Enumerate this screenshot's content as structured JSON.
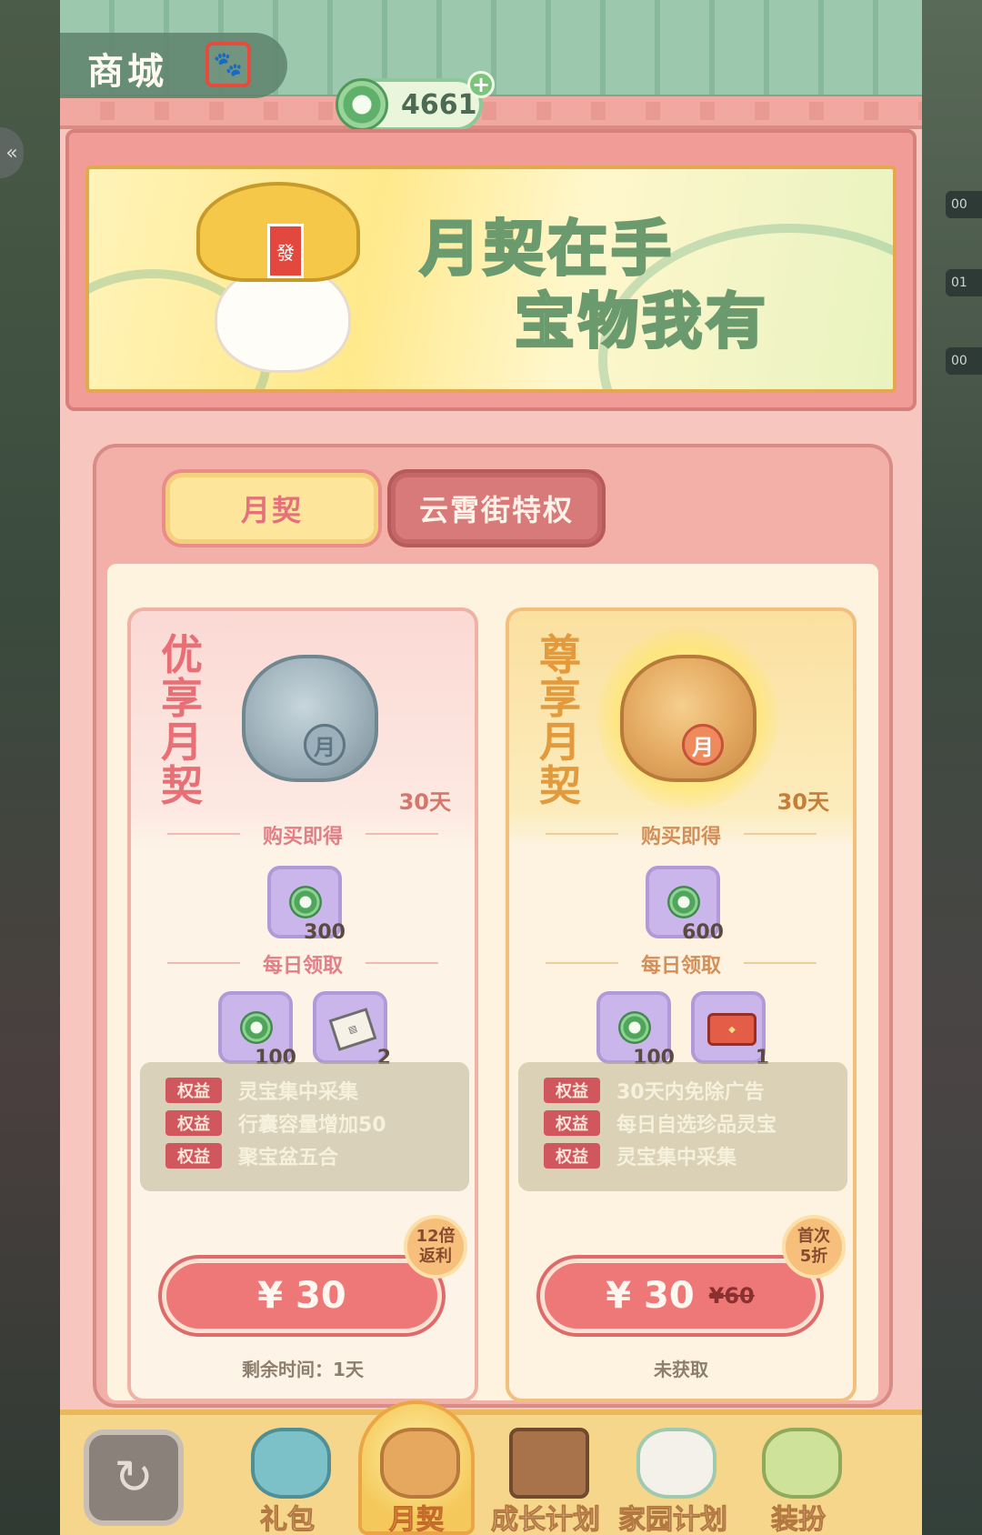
{
  "header": {
    "title": "商城",
    "title_stamp": "🐾",
    "currency": {
      "icon": "jade-coin-icon",
      "value": "4661",
      "add_label": "+"
    }
  },
  "banner": {
    "line1": "月契在手",
    "line2": "宝物我有",
    "hat_tag": "發"
  },
  "tabs": [
    {
      "label": "月契",
      "active": true
    },
    {
      "label": "云霄街特权",
      "active": false
    }
  ],
  "cards": [
    {
      "name": "优享月契",
      "days": "30天",
      "mascot_tag": "月",
      "buy_section": "购买即得",
      "buy_items": [
        {
          "icon": "jade-coin-icon",
          "qty": "300"
        }
      ],
      "daily_section": "每日领取",
      "daily_items": [
        {
          "icon": "jade-coin-icon",
          "qty": "100"
        },
        {
          "icon": "scroll-ticket-icon",
          "qty": "2"
        }
      ],
      "benefits": [
        {
          "tag": "权益",
          "text": "灵宝集中采集"
        },
        {
          "tag": "权益",
          "text": "行囊容量增加50"
        },
        {
          "tag": "权益",
          "text": "聚宝盆五合"
        }
      ],
      "badge": "12倍\n返利",
      "price": "¥ 30",
      "price_old": "",
      "status": "剩余时间：1天"
    },
    {
      "name": "尊享月契",
      "days": "30天",
      "mascot_tag": "月",
      "buy_section": "购买即得",
      "buy_items": [
        {
          "icon": "jade-coin-icon",
          "qty": "600"
        }
      ],
      "daily_section": "每日领取",
      "daily_items": [
        {
          "icon": "jade-coin-icon",
          "qty": "100"
        },
        {
          "icon": "treasure-chest-icon",
          "qty": "1"
        }
      ],
      "benefits": [
        {
          "tag": "权益",
          "text": "30天内免除广告"
        },
        {
          "tag": "权益",
          "text": "每日自选珍品灵宝"
        },
        {
          "tag": "权益",
          "text": "灵宝集中采集"
        }
      ],
      "badge": "首次\n5折",
      "price": "¥ 30",
      "price_old": "¥60",
      "status": "未获取"
    }
  ],
  "bottom_nav": {
    "back_icon": "back-arrow-icon",
    "items": [
      {
        "label": "礼包",
        "icon": "gift-bag-icon",
        "active": false
      },
      {
        "label": "月契",
        "icon": "mascot-cat-icon",
        "active": true
      },
      {
        "label": "成长计划",
        "icon": "growth-chest-icon",
        "active": false
      },
      {
        "label": "家园计划",
        "icon": "cat-spirit-icon",
        "active": false
      },
      {
        "label": "装扮",
        "icon": "costume-icon",
        "active": false
      }
    ]
  },
  "side": {
    "handle": "«",
    "chip_top": "00",
    "chip_mid": "01",
    "chip_bot": "00"
  },
  "colors": {
    "accent": "#ee7878",
    "tab_active": "#fde59b",
    "jade": "#4ea65c"
  }
}
